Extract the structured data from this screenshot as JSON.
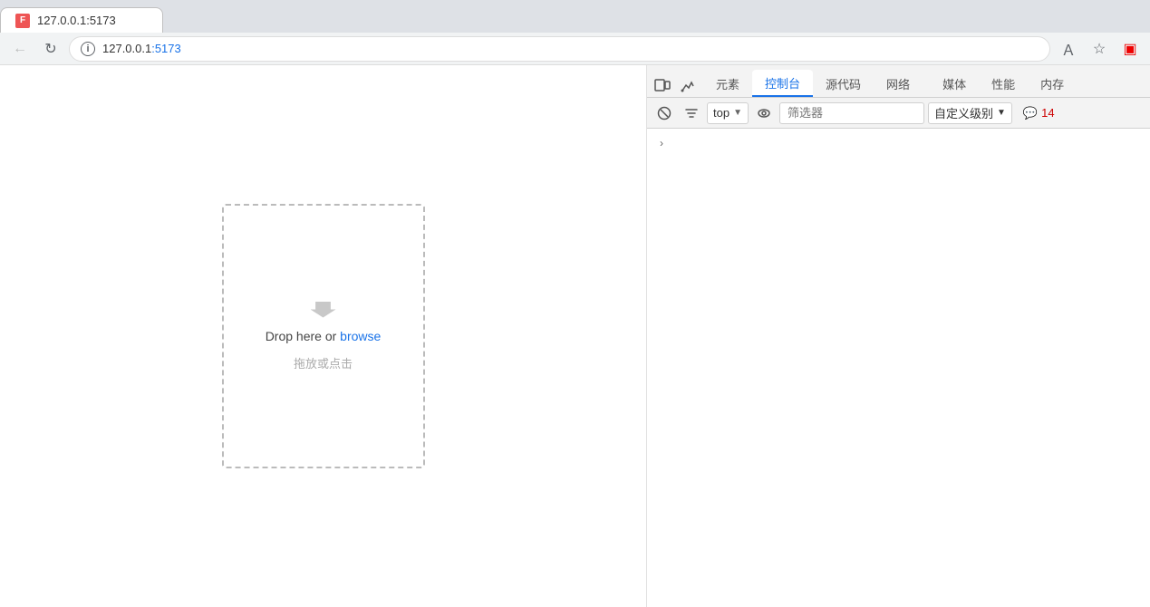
{
  "browser": {
    "tab_label": "127.0.0.1:5173",
    "address": "127.0.0.1:5173",
    "address_prefix": "127.0.0.1",
    "address_suffix": ":5173"
  },
  "devtools": {
    "tabs": [
      {
        "id": "elements",
        "label": "元素"
      },
      {
        "id": "console",
        "label": "控制台",
        "active": true
      },
      {
        "id": "sources",
        "label": "源代码"
      },
      {
        "id": "network",
        "label": "网络"
      },
      {
        "id": "media",
        "label": "媒体"
      },
      {
        "id": "performance",
        "label": "性能"
      },
      {
        "id": "memory",
        "label": "内存"
      }
    ],
    "toolbar": {
      "context_value": "top",
      "filter_placeholder": "筛选器",
      "level_label": "自定义级别",
      "message_count": "14"
    }
  },
  "webpage": {
    "drop_text": "Drop here or ",
    "browse_label": "browse",
    "drop_subtext": "拖放或点击"
  },
  "icons": {
    "back": "←",
    "refresh": "↻",
    "forward": "→",
    "bookmark": "☆",
    "profile": "⊙",
    "menu": "⋮",
    "expand": "›",
    "down_arrow": "▼",
    "eye": "◎",
    "info": "i",
    "chat_bubble": "💬"
  }
}
